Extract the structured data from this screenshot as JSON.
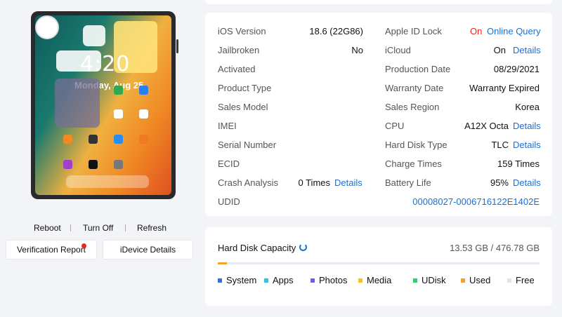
{
  "device_actions": {
    "reboot": "Reboot",
    "turn_off": "Turn Off",
    "refresh": "Refresh",
    "verification_report": "Verification Report",
    "idevice_details": "iDevice Details"
  },
  "device_screen": {
    "time": "4:20",
    "date": "Monday, Aug 25"
  },
  "info": {
    "left": [
      {
        "label": "iOS Version",
        "value": "18.6 (22G86)"
      },
      {
        "label": "Jailbroken",
        "value": "No"
      },
      {
        "label": "Activated",
        "value": ""
      },
      {
        "label": "Product Type",
        "value": ""
      },
      {
        "label": "Sales Model",
        "value": ""
      },
      {
        "label": "IMEI",
        "value": ""
      },
      {
        "label": "Serial Number",
        "value": ""
      },
      {
        "label": "ECID",
        "value": ""
      },
      {
        "label": "Crash Analysis",
        "value": "0 Times",
        "link": "Details"
      },
      {
        "label": "UDID",
        "value": ""
      }
    ],
    "right": [
      {
        "label": "Apple ID Lock",
        "status": "On",
        "link": "Online Query"
      },
      {
        "label": "iCloud",
        "value": "On",
        "link": "Details"
      },
      {
        "label": "Production Date",
        "value": "08/29/2021"
      },
      {
        "label": "Warranty Date",
        "value": "Warranty Expired"
      },
      {
        "label": "Sales Region",
        "value": "Korea"
      },
      {
        "label": "CPU",
        "value": "A12X Octa",
        "link": "Details"
      },
      {
        "label": "Hard Disk Type",
        "value": "TLC",
        "link": "Details"
      },
      {
        "label": "Charge Times",
        "value": "159 Times"
      },
      {
        "label": "Battery Life",
        "value": "95%",
        "link": "Details"
      }
    ],
    "udid_value": "00008027-0006716122E1402E"
  },
  "disk": {
    "title": "Hard Disk Capacity",
    "capacity": "13.53 GB / 476.78 GB",
    "used_fraction": 0.028,
    "legend": [
      {
        "name": "System",
        "color": "#2f6fe0"
      },
      {
        "name": "Apps",
        "color": "#2ec4e8"
      },
      {
        "name": "Photos",
        "color": "#6a5fe0"
      },
      {
        "name": "Media",
        "color": "#f2c21a"
      },
      {
        "name": "UDisk",
        "color": "#2ecf6a"
      },
      {
        "name": "Used",
        "color": "#f2a234"
      },
      {
        "name": "Free",
        "color": "#dfe6ef"
      }
    ]
  }
}
